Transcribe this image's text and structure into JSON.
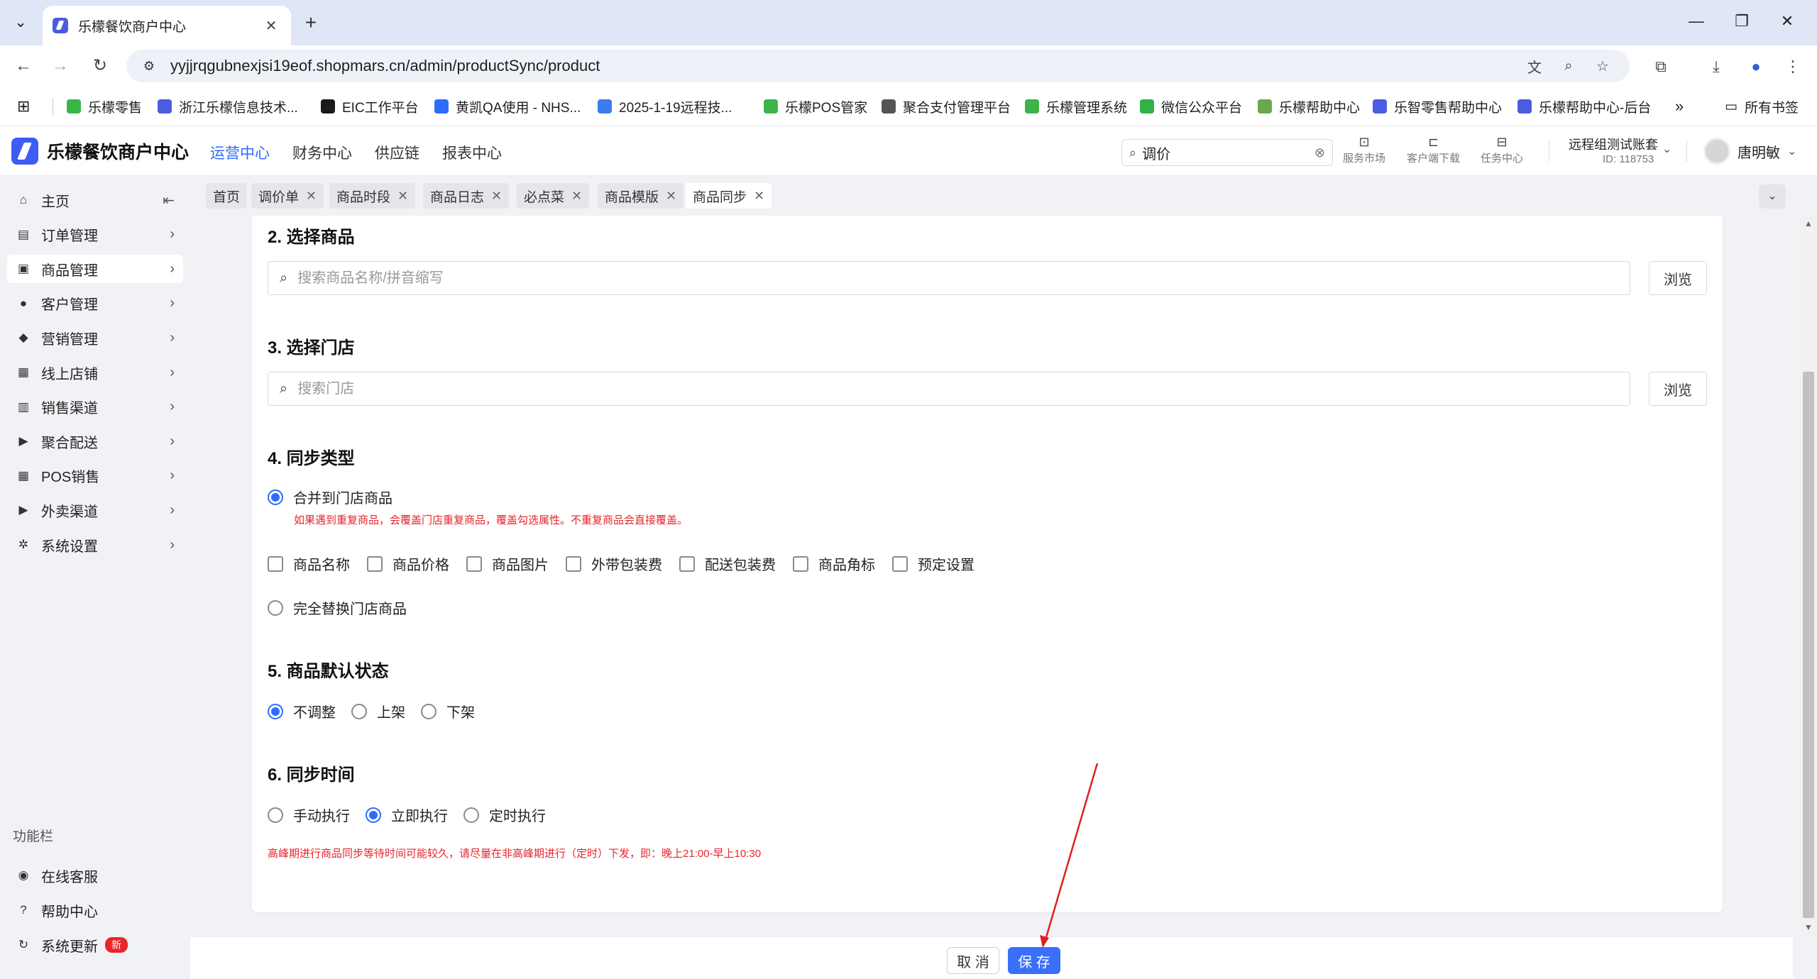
{
  "browser": {
    "tab_title": "乐檬餐饮商户中心",
    "tab_close": "✕",
    "new_tab": "+",
    "url": "yyjjrqgubnexjsi19eof.shopmars.cn/admin/productSync/product",
    "bookmarks": [
      {
        "label": "乐檬零售",
        "color": "#3bb54a"
      },
      {
        "label": "浙江乐檬信息技术...",
        "color": "#4a5de0"
      },
      {
        "label": "EIC工作平台",
        "color": "#1a1a1a"
      },
      {
        "label": "黄凯QA使用 - NHS...",
        "color": "#2f6bff"
      },
      {
        "label": "2025-1-19远程技...",
        "color": "#3d7bf0"
      },
      {
        "label": "乐檬POS管家",
        "color": "#3bb54a"
      },
      {
        "label": "聚合支付管理平台",
        "color": "#555555"
      },
      {
        "label": "乐檬管理系统",
        "color": "#3bb54a"
      },
      {
        "label": "微信公众平台",
        "color": "#2fb344"
      },
      {
        "label": "乐檬帮助中心",
        "color": "#6aa84f"
      },
      {
        "label": "乐智零售帮助中心",
        "color": "#4a5de0"
      },
      {
        "label": "乐檬帮助中心-后台",
        "color": "#4a5de0"
      }
    ],
    "bookmarks_more": "»",
    "all_bookmarks": "所有书签"
  },
  "header": {
    "logo_text": "乐檬餐饮商户中心",
    "nav": [
      "运营中心",
      "财务中心",
      "供应链",
      "报表中心"
    ],
    "active_nav": 0,
    "search_value": "调价",
    "tools": [
      "服务市场",
      "客户端下载",
      "任务中心"
    ],
    "account_name": "远程组测试账套",
    "account_id": "ID: 118753",
    "user_name": "唐明敏"
  },
  "sidebar": {
    "items": [
      {
        "label": "主页",
        "icon": "home-icon",
        "glyph": "⌂"
      },
      {
        "label": "订单管理",
        "icon": "order-icon",
        "glyph": "▤"
      },
      {
        "label": "商品管理",
        "icon": "product-icon",
        "glyph": "▣"
      },
      {
        "label": "客户管理",
        "icon": "user-icon",
        "glyph": "●"
      },
      {
        "label": "营销管理",
        "icon": "tag-icon",
        "glyph": "◆"
      },
      {
        "label": "线上店铺",
        "icon": "store-icon",
        "glyph": "▦"
      },
      {
        "label": "销售渠道",
        "icon": "bank-icon",
        "glyph": "▥"
      },
      {
        "label": "聚合配送",
        "icon": "delivery-icon",
        "glyph": "▶"
      },
      {
        "label": "POS销售",
        "icon": "pos-icon",
        "glyph": "▦"
      },
      {
        "label": "外卖渠道",
        "icon": "takeout-icon",
        "glyph": "▶"
      },
      {
        "label": "系统设置",
        "icon": "gear-icon",
        "glyph": "✲"
      }
    ],
    "section_label": "功能栏",
    "footer_items": [
      {
        "label": "在线客服",
        "icon": "service-icon",
        "glyph": "◉"
      },
      {
        "label": "帮助中心",
        "icon": "help-icon",
        "glyph": "?"
      },
      {
        "label": "系统更新",
        "icon": "refresh-icon",
        "glyph": "↻",
        "badge": "新"
      }
    ]
  },
  "tags": [
    {
      "label": "首页",
      "closable": false
    },
    {
      "label": "调价单",
      "closable": true
    },
    {
      "label": "商品时段",
      "closable": true
    },
    {
      "label": "商品日志",
      "closable": true
    },
    {
      "label": "必点菜",
      "closable": true
    },
    {
      "label": "商品模版",
      "closable": true
    },
    {
      "label": "商品同步",
      "closable": true,
      "active": true
    }
  ],
  "form": {
    "s2_title": "2. 选择商品",
    "s2_placeholder": "搜索商品名称/拼音缩写",
    "s3_title": "3. 选择门店",
    "s3_placeholder": "搜索门店",
    "browse_label": "浏览",
    "s4_title": "4. 同步类型",
    "merge_label": "合并到门店商品",
    "merge_hint": "如果遇到重复商品，会覆盖门店重复商品，覆盖勾选属性。不重复商品会直接覆盖。",
    "merge_fields": [
      "商品名称",
      "商品价格",
      "商品图片",
      "外带包装费",
      "配送包装费",
      "商品角标",
      "预定设置"
    ],
    "replace_label": "完全替换门店商品",
    "sync_type_selected": "合并到门店商品",
    "s5_title": "5. 商品默认状态",
    "status_options": [
      "不调整",
      "上架",
      "下架"
    ],
    "status_selected": "不调整",
    "s6_title": "6. 同步时间",
    "time_options": [
      "手动执行",
      "立即执行",
      "定时执行"
    ],
    "time_selected": "立即执行",
    "time_hint": "高峰期进行商品同步等待时间可能较久，请尽量在非高峰期进行（定时）下发，即：晚上21:00-早上10:30"
  },
  "footer": {
    "cancel_label": "取 消",
    "save_label": "保 存"
  },
  "colors": {
    "accent": "#2f6bff",
    "save_button": "#3a6ff7",
    "hint_red": "#e8242b",
    "annotation_arrow": "#e02020"
  }
}
